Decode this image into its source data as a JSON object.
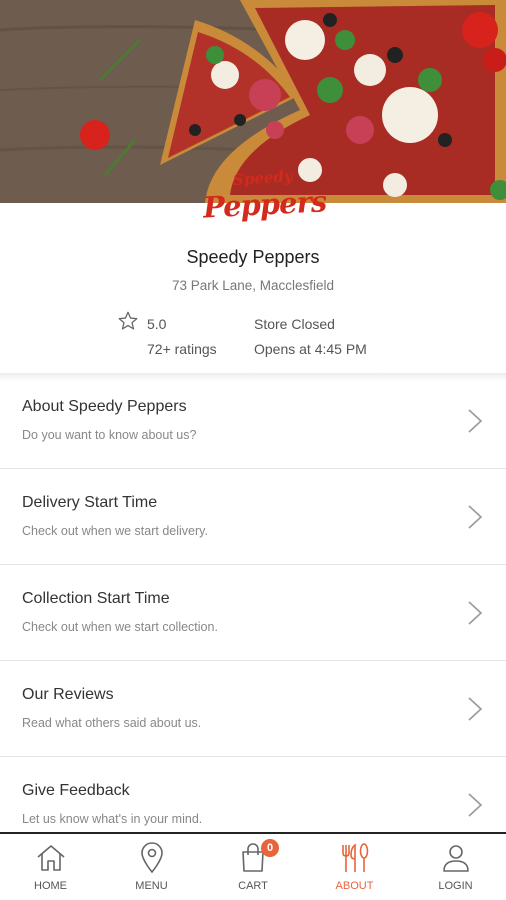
{
  "hero": {
    "logo_small": "Speedy",
    "logo_main": "Peppers"
  },
  "store": {
    "name": "Speedy Peppers",
    "address": "73 Park Lane, Macclesfield",
    "rating": "5.0",
    "ratings_count": "72+ ratings",
    "status": "Store Closed",
    "opens": "Opens at 4:45 PM"
  },
  "menu_items": [
    {
      "title": "About Speedy Peppers",
      "subtitle": "Do you want to know about us?"
    },
    {
      "title": "Delivery Start Time",
      "subtitle": "Check out when we start delivery."
    },
    {
      "title": "Collection Start Time",
      "subtitle": "Check out when we start collection."
    },
    {
      "title": "Our Reviews",
      "subtitle": "Read what others said about us."
    },
    {
      "title": "Give Feedback",
      "subtitle": "Let us know what's in your mind."
    }
  ],
  "nav": {
    "home": "HOME",
    "menu": "MENU",
    "cart": "CART",
    "cart_count": "0",
    "about": "ABOUT",
    "login": "LOGIN"
  },
  "colors": {
    "accent": "#e8643b",
    "brand_red": "#d42a1e"
  }
}
